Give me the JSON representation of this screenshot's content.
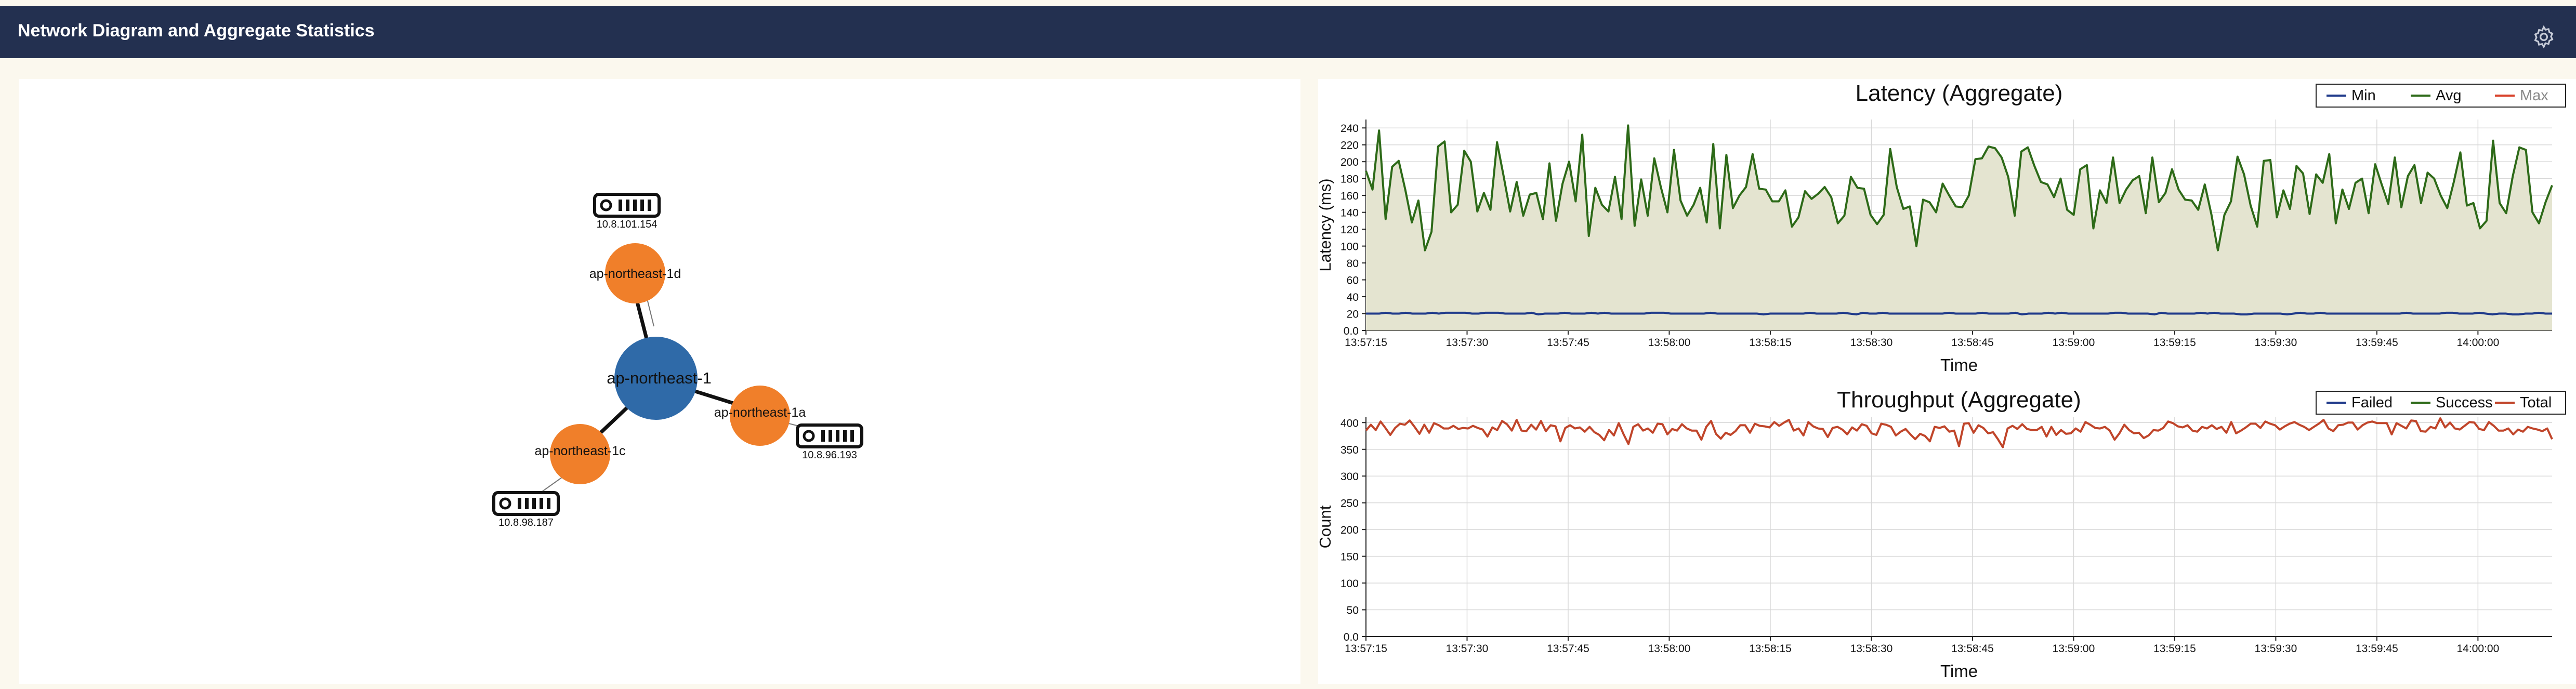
{
  "header": {
    "title": "Network Diagram and Aggregate Statistics",
    "settings_icon": "gear-icon"
  },
  "network": {
    "center": {
      "label": "ap-northeast-1",
      "color": "#2f6aa8"
    },
    "zones": [
      {
        "label": "ap-northeast-1d",
        "color": "#f07f2a",
        "server_ip": "10.8.101.154"
      },
      {
        "label": "ap-northeast-1a",
        "color": "#f07f2a",
        "server_ip": "10.8.96.193"
      },
      {
        "label": "ap-northeast-1c",
        "color": "#f07f2a",
        "server_ip": "10.8.98.187"
      }
    ],
    "server_icon": "server-icon"
  },
  "chart_data": [
    {
      "type": "area",
      "title": "Latency (Aggregate)",
      "xlabel": "Time",
      "ylabel": "Latency (ms)",
      "ylim": [
        0,
        250
      ],
      "yticks": [
        "0.0",
        "20",
        "40",
        "60",
        "80",
        "100",
        "120",
        "140",
        "160",
        "180",
        "200",
        "220",
        "240"
      ],
      "xticks": [
        "13:57:15",
        "13:57:30",
        "13:57:45",
        "13:58:00",
        "13:58:15",
        "13:58:30",
        "13:58:45",
        "13:59:00",
        "13:59:15",
        "13:59:30",
        "13:59:45",
        "14:00:00"
      ],
      "x_start": "13:57:15",
      "x_end": "14:00:11",
      "grid": true,
      "legend_position": "top-right",
      "series": [
        {
          "name": "Min",
          "color": "#1f3a8a",
          "values": [
            20,
            20,
            20,
            21,
            20,
            20,
            21,
            20,
            20,
            20,
            21,
            20,
            21,
            21,
            21,
            21,
            20,
            20,
            21,
            21,
            21,
            20,
            20,
            20,
            20,
            21,
            19,
            20,
            20,
            20,
            21,
            20,
            20,
            20,
            21,
            20,
            21,
            20,
            20,
            20,
            20,
            20,
            20,
            21,
            21,
            21,
            20,
            20,
            20,
            20,
            20,
            20,
            21,
            20,
            20,
            20,
            20,
            20,
            20,
            20,
            19,
            20,
            20,
            20,
            20,
            20,
            20,
            21,
            20,
            20,
            20,
            20,
            21,
            20,
            19,
            21,
            20,
            20,
            21,
            20,
            20,
            20,
            20,
            20,
            20,
            20,
            20,
            20,
            21,
            20,
            20,
            20,
            20,
            21,
            20,
            20,
            20,
            20,
            21,
            19,
            20,
            20,
            20,
            21,
            20,
            21,
            20,
            20,
            20,
            20,
            20,
            20,
            20,
            21,
            21,
            20,
            20,
            20,
            20,
            19,
            21,
            20,
            20,
            20,
            20,
            20,
            21,
            20,
            21,
            20,
            20,
            20,
            19,
            19,
            20,
            20,
            20,
            20,
            20,
            19,
            20,
            21,
            20,
            20,
            21,
            20,
            20,
            20,
            20,
            20,
            20,
            20,
            20,
            20,
            20,
            20,
            20,
            21,
            20,
            20,
            20,
            20,
            20,
            21,
            21,
            20,
            20,
            20,
            21,
            20,
            19,
            20,
            20,
            19,
            19,
            20,
            20,
            21,
            20,
            20
          ]
        },
        {
          "name": "Avg",
          "color": "#2d6a18",
          "values": [
            189,
            167,
            237,
            132,
            194,
            201,
            167,
            128,
            154,
            95,
            117,
            218,
            224,
            140,
            149,
            213,
            200,
            141,
            163,
            143,
            223,
            183,
            141,
            176,
            136,
            161,
            163,
            132,
            198,
            130,
            174,
            200,
            153,
            232,
            112,
            169,
            149,
            141,
            182,
            132,
            243,
            124,
            179,
            136,
            204,
            170,
            140,
            214,
            154,
            136,
            149,
            169,
            128,
            221,
            121,
            208,
            145,
            160,
            170,
            209,
            168,
            167,
            153,
            153,
            166,
            123,
            134,
            165,
            156,
            162,
            170,
            158,
            127,
            136,
            182,
            169,
            168,
            137,
            126,
            137,
            215,
            170,
            144,
            147,
            100,
            155,
            152,
            140,
            174,
            160,
            147,
            146,
            160,
            203,
            204,
            218,
            216,
            205,
            182,
            136,
            212,
            217,
            195,
            176,
            173,
            158,
            180,
            143,
            137,
            191,
            196,
            121,
            166,
            151,
            205,
            151,
            167,
            178,
            183,
            139,
            205,
            152,
            163,
            191,
            167,
            155,
            154,
            143,
            173,
            138,
            95,
            137,
            153,
            206,
            185,
            148,
            123,
            201,
            202,
            134,
            166,
            144,
            195,
            186,
            138,
            185,
            175,
            209,
            127,
            167,
            144,
            175,
            180,
            139,
            197,
            173,
            150,
            205,
            146,
            183,
            196,
            151,
            187,
            180,
            160,
            145,
            176,
            211,
            148,
            151,
            121,
            130,
            225,
            151,
            139,
            183,
            217,
            214,
            140,
            127,
            152,
            172
          ]
        },
        {
          "name": "Max",
          "color": "#d8412a",
          "values": []
        }
      ]
    },
    {
      "type": "line",
      "title": "Throughput (Aggregate)",
      "xlabel": "Time",
      "ylabel": "Count",
      "ylim": [
        0,
        410
      ],
      "yticks": [
        "0.0",
        "50",
        "100",
        "150",
        "200",
        "250",
        "300",
        "350",
        "400"
      ],
      "xticks": [
        "13:57:15",
        "13:57:30",
        "13:57:45",
        "13:58:00",
        "13:58:15",
        "13:58:30",
        "13:58:45",
        "13:59:00",
        "13:59:15",
        "13:59:30",
        "13:59:45",
        "14:00:00"
      ],
      "x_start": "13:57:15",
      "x_end": "14:00:11",
      "grid": true,
      "legend_position": "top-right",
      "series": [
        {
          "name": "Failed",
          "color": "#1f3a8a",
          "values": []
        },
        {
          "name": "Success",
          "color": "#2d6a18",
          "values": []
        },
        {
          "name": "Total",
          "color": "#c0452a",
          "values": [
            385,
            396,
            386,
            402,
            390,
            377,
            390,
            398,
            396,
            404,
            392,
            379,
            396,
            381,
            399,
            395,
            389,
            389,
            394,
            388,
            390,
            389,
            394,
            390,
            387,
            374,
            391,
            386,
            403,
            397,
            385,
            405,
            385,
            384,
            396,
            387,
            403,
            384,
            395,
            393,
            365,
            390,
            395,
            389,
            391,
            383,
            392,
            382,
            377,
            367,
            386,
            376,
            399,
            378,
            360,
            392,
            397,
            385,
            389,
            381,
            398,
            397,
            378,
            388,
            385,
            397,
            389,
            385,
            385,
            368,
            392,
            403,
            379,
            370,
            381,
            377,
            384,
            395,
            395,
            381,
            398,
            394,
            393,
            391,
            401,
            394,
            400,
            405,
            385,
            389,
            376,
            401,
            393,
            389,
            388,
            373,
            390,
            392,
            387,
            378,
            391,
            385,
            397,
            394,
            380,
            377,
            398,
            396,
            392,
            376,
            383,
            388,
            378,
            369,
            379,
            375,
            365,
            392,
            390,
            393,
            383,
            385,
            356,
            398,
            399,
            381,
            395,
            390,
            380,
            382,
            369,
            354,
            389,
            394,
            388,
            397,
            388,
            386,
            386,
            392,
            374,
            392,
            377,
            386,
            379,
            380,
            389,
            383,
            401,
            396,
            390,
            389,
            392,
            385,
            368,
            380,
            396,
            386,
            380,
            381,
            371,
            376,
            386,
            385,
            390,
            402,
            399,
            393,
            391,
            395,
            385,
            383,
            392,
            389,
            395,
            388,
            392,
            381,
            401,
            380,
            385,
            391,
            398,
            398,
            390,
            402,
            398,
            395,
            387,
            393,
            398,
            401,
            396,
            392,
            386,
            392,
            398,
            405,
            389,
            384,
            395,
            396,
            400,
            400,
            387,
            395,
            400,
            402,
            399,
            399,
            399,
            378,
            399,
            394,
            389,
            404,
            403,
            384,
            383,
            392,
            389,
            408,
            391,
            400,
            389,
            387,
            394,
            401,
            400,
            388,
            386,
            401,
            394,
            385,
            385,
            389,
            378,
            387,
            383,
            392,
            389,
            387,
            384,
            389,
            369
          ]
        }
      ]
    }
  ]
}
